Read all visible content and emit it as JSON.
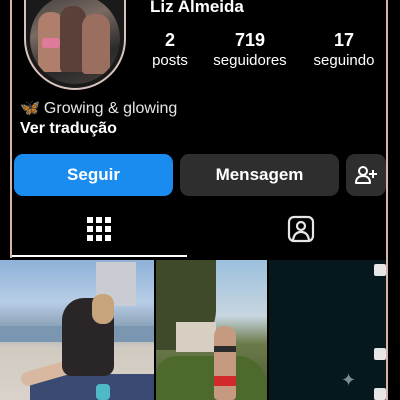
{
  "profile": {
    "username": "Liz Almeida",
    "stats": {
      "posts": {
        "value": "2",
        "label": "posts"
      },
      "followers": {
        "value": "719",
        "label": "seguidores"
      },
      "following": {
        "value": "17",
        "label": "seguindo"
      }
    },
    "bio": "Growing & glowing",
    "bio_icon": "butterfly-emoji",
    "translate_label": "Ver tradução"
  },
  "actions": {
    "follow_label": "Seguir",
    "message_label": "Mensagem",
    "add_user_icon": "add-person-icon"
  },
  "tabs": {
    "grid_icon": "grid-icon",
    "tagged_icon": "tagged-person-icon",
    "active": "grid"
  },
  "colors": {
    "follow_button": "#1a8cf0",
    "secondary_button": "#2e2e2e",
    "background": "#000000"
  },
  "grid": {
    "photos": [
      {
        "icon": "beach-photo"
      },
      {
        "icon": "garden-photo"
      },
      {
        "icon": "dark-photo"
      }
    ]
  }
}
